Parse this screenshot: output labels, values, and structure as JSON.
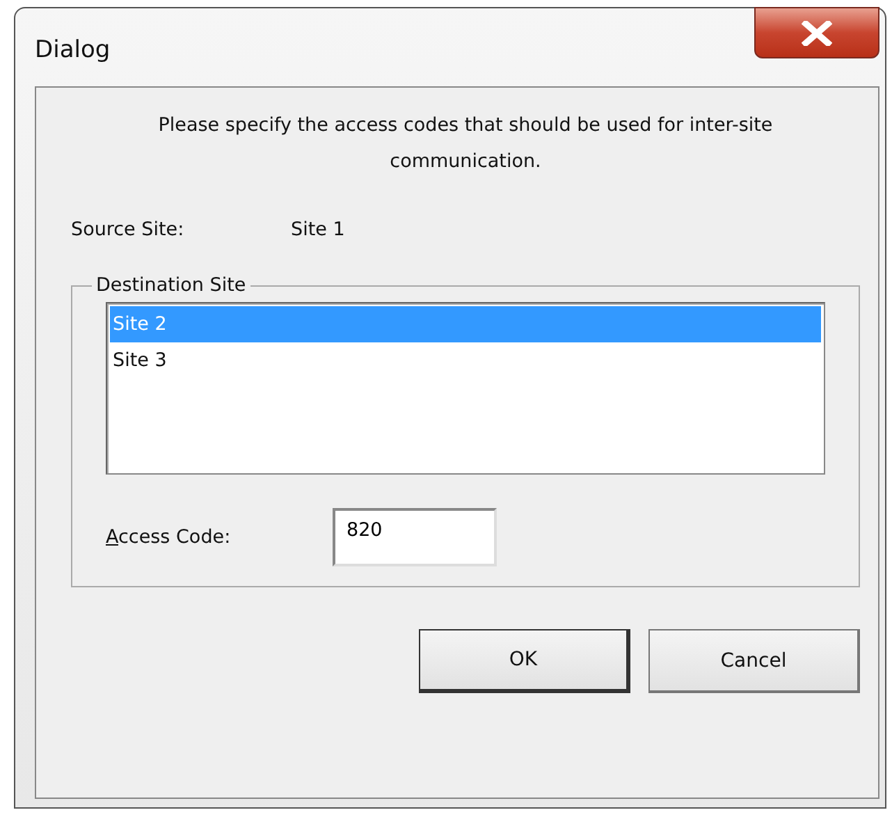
{
  "window": {
    "title": "Dialog"
  },
  "intro": "Please specify the access codes that should be used for inter-site communication.",
  "source": {
    "label": "Source Site:",
    "value": "Site 1"
  },
  "destination": {
    "legend": "Destination Site",
    "sites": [
      {
        "label": "Site 2",
        "selected": true
      },
      {
        "label": "Site 3",
        "selected": false
      }
    ]
  },
  "access_code": {
    "label": "Access Code:",
    "value": "820"
  },
  "buttons": [
    {
      "label": "OK",
      "default": true
    },
    {
      "label": "Cancel",
      "default": false
    }
  ]
}
